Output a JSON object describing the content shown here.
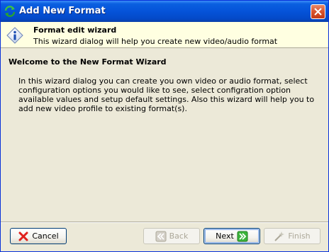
{
  "window": {
    "title": "Add New Format"
  },
  "header": {
    "title": "Format edit wizard",
    "subtitle": "This wizard dialog will help you create new video/audio format"
  },
  "main": {
    "welcome_title": "Welcome to the New Format Wizard",
    "welcome_body": "In this wizard dialog you can create you own video or audio format, select configuration options you would like to see, select configration option available values and setup default settings. Also this wizard will help you to add new video profile to existing format(s)."
  },
  "buttons": {
    "cancel": "Cancel",
    "back": "Back",
    "next": "Next",
    "finish": "Finish"
  },
  "icons": {
    "app": "refresh-arrows-icon",
    "info": "info-icon",
    "close": "close-icon",
    "cancel": "red-x-icon",
    "back": "double-arrow-left-icon",
    "next": "double-arrow-right-icon",
    "finish": "wand-icon"
  }
}
